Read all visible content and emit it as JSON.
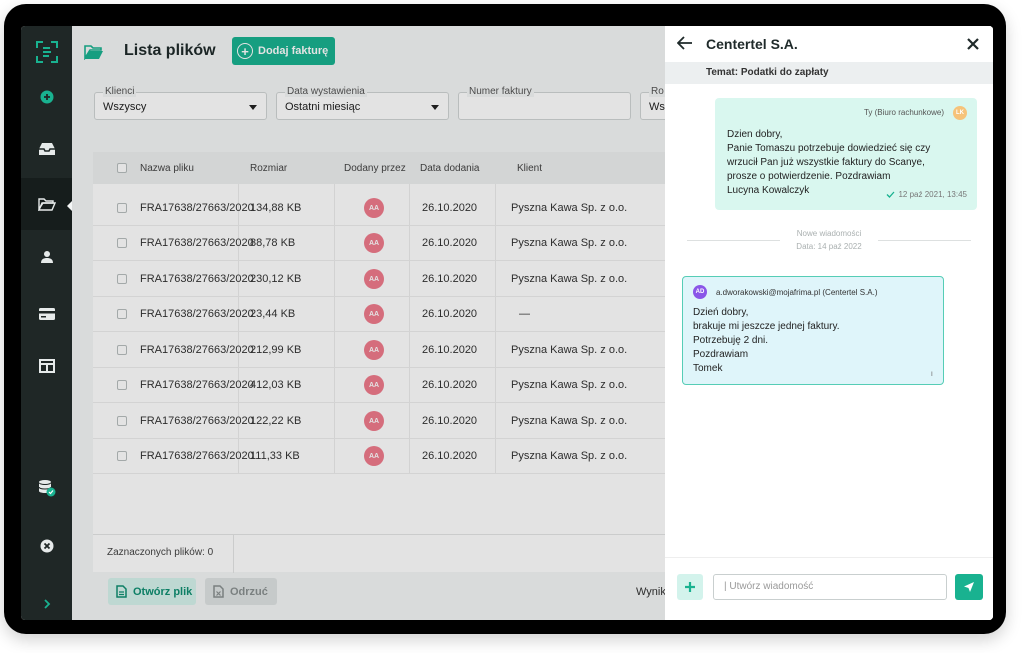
{
  "sidebar": {
    "icons": [
      "logo-icon",
      "add-circle-icon",
      "inbox-icon",
      "folder-open-icon",
      "user-icon",
      "credit-card-icon",
      "layout-icon",
      "database-check-icon",
      "close-circle-icon",
      "chevron-right-icon"
    ],
    "accent": "#19b290"
  },
  "header": {
    "title": "Lista plików",
    "add_label": "Dodaj fakturę"
  },
  "filters": [
    {
      "label": "Klienci",
      "value": "Wszyscy"
    },
    {
      "label": "Data wystawienia",
      "value": "Ostatni miesiąc"
    },
    {
      "label": "Numer faktury",
      "value": ""
    },
    {
      "label": "Ro",
      "value": "Wsz"
    }
  ],
  "table": {
    "columns": [
      "Nazwa pliku",
      "Rozmiar",
      "Dodany przez",
      "Data dodania",
      "Klient"
    ],
    "rows": [
      {
        "name": "FRA17638/27663/2020",
        "size": "134,88 KB",
        "by": "AA",
        "date": "26.10.2020",
        "client": "Pyszna Kawa Sp. z o.o."
      },
      {
        "name": "FRA17638/27663/2020",
        "size": "88,78 KB",
        "by": "AA",
        "date": "26.10.2020",
        "client": "Pyszna Kawa Sp. z o.o."
      },
      {
        "name": "FRA17638/27663/2020",
        "size": "230,12 KB",
        "by": "AA",
        "date": "26.10.2020",
        "client": "Pyszna Kawa Sp. z o.o."
      },
      {
        "name": "FRA17638/27663/2020",
        "size": "23,44 KB",
        "by": "AA",
        "date": "26.10.2020",
        "client": "—"
      },
      {
        "name": "FRA17638/27663/2020",
        "size": "212,99 KB",
        "by": "AA",
        "date": "26.10.2020",
        "client": "Pyszna Kawa Sp. z o.o."
      },
      {
        "name": "FRA17638/27663/2020",
        "size": "412,03 KB",
        "by": "AA",
        "date": "26.10.2020",
        "client": "Pyszna Kawa Sp. z o.o."
      },
      {
        "name": "FRA17638/27663/2020",
        "size": "122,22 KB",
        "by": "AA",
        "date": "26.10.2020",
        "client": "Pyszna Kawa Sp. z o.o."
      },
      {
        "name": "FRA17638/27663/2020",
        "size": "111,33 KB",
        "by": "AA",
        "date": "26.10.2020",
        "client": "Pyszna Kawa Sp. z o.o."
      }
    ]
  },
  "footer": {
    "selected": "Zaznaczonych plików: 0",
    "open_label": "Otwórz plik",
    "reject_label": "Odrzuć",
    "results": "Wynik"
  },
  "drawer": {
    "title": "Centertel S.A.",
    "topic": "Temat: Podatki do zapłaty",
    "outgoing": {
      "sender": "Ty (Biuro rachunkowe)",
      "initials": "LK",
      "lines": [
        "Dzien dobry,",
        "Panie Tomaszu  potrzebuje dowiedzieć się czy",
        "wrzucił Pan już wszystkie faktury do Scanye,",
        "prosze o potwierdzenie. Pozdrawiam",
        "Lucyna Kowalczyk"
      ],
      "time": "12 paź 2021, 13:45"
    },
    "new_messages": {
      "label": "Nowe wiadomości",
      "date": "Data: 14 paź 2022"
    },
    "incoming": {
      "initials": "AD",
      "sender": "a.dworakowski@mojafrima.pl (Centertel S.A.)",
      "lines": [
        "Dzień dobry,",
        "brakuje mi jeszcze jednej faktury.",
        "Potrzebuję 2 dni.",
        "Pozdrawiam",
        "Tomek"
      ],
      "marker": "ı"
    },
    "input_placeholder": "| Utwórz wiadomość"
  }
}
